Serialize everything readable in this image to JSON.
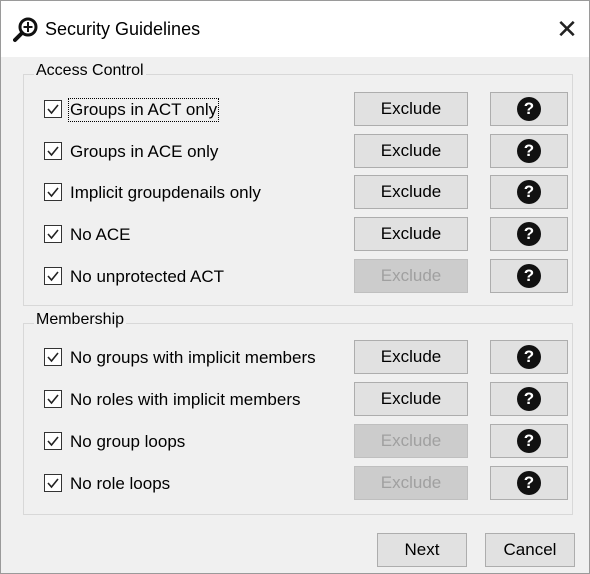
{
  "window": {
    "title": "Security Guidelines",
    "close_label": "✕"
  },
  "access_control": {
    "label": "Access Control",
    "rows": [
      {
        "label": "Groups in ACT only",
        "checked": true,
        "exclude_label": "Exclude",
        "exclude_enabled": true
      },
      {
        "label": "Groups in ACE only",
        "checked": true,
        "exclude_label": "Exclude",
        "exclude_enabled": true
      },
      {
        "label": "Implicit groupdenails only",
        "checked": true,
        "exclude_label": "Exclude",
        "exclude_enabled": true
      },
      {
        "label": "No ACE",
        "checked": true,
        "exclude_label": "Exclude",
        "exclude_enabled": true
      },
      {
        "label": "No unprotected ACT",
        "checked": true,
        "exclude_label": "Exclude",
        "exclude_enabled": false
      }
    ]
  },
  "membership": {
    "label": "Membership",
    "rows": [
      {
        "label": "No groups with implicit members",
        "checked": true,
        "exclude_label": "Exclude",
        "exclude_enabled": true
      },
      {
        "label": "No roles with implicit members",
        "checked": true,
        "exclude_label": "Exclude",
        "exclude_enabled": true
      },
      {
        "label": "No group loops",
        "checked": true,
        "exclude_label": "Exclude",
        "exclude_enabled": false
      },
      {
        "label": "No role loops",
        "checked": true,
        "exclude_label": "Exclude",
        "exclude_enabled": false
      }
    ]
  },
  "help_glyph": "?",
  "footer": {
    "next_label": "Next",
    "cancel_label": "Cancel"
  }
}
